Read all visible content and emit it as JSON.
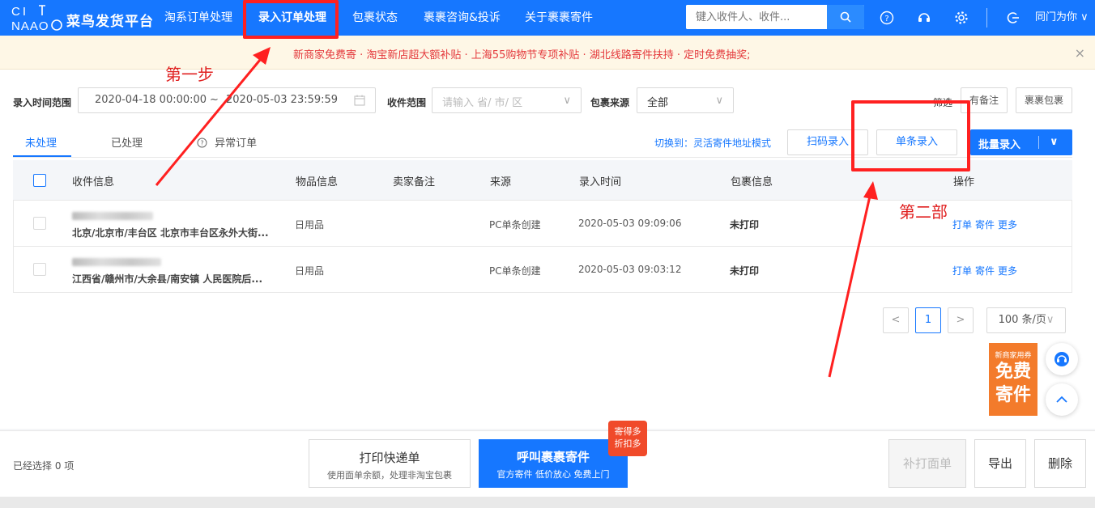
{
  "nav": {
    "logo_text": "菜鸟发货平台",
    "items": [
      "淘系订单处理",
      "录入订单处理",
      "包裹状态",
      "裹裹咨询&投诉",
      "关于裹裹寄件"
    ],
    "search_placeholder": "键入收件人、收件...",
    "user": "同门为你"
  },
  "notice": {
    "text": "新商家免费寄 · 淘宝新店超大额补贴 · 上海55购物节专项补贴 · 湖北线路寄件扶持 · 定时免费抽奖;",
    "close": "×"
  },
  "filters": {
    "time_label": "录入时间范围",
    "start": "2020-04-18 00:00:00",
    "sep": "~",
    "end": "2020-05-03 23:59:59",
    "area_label": "收件范围",
    "area_placeholder": "请输入 省/ 市/ 区",
    "source_label": "包裹来源",
    "source_value": "全部",
    "screen_label": "筛选",
    "has_note": "有备注",
    "guoguo": "裹裹包裹"
  },
  "tabs": [
    "未处理",
    "已处理",
    "异常订单"
  ],
  "actions": {
    "switch": "切换到：灵活寄件地址模式",
    "scan": "扫码录入",
    "single": "单条录入",
    "batch": "批量录入"
  },
  "table": {
    "headers": [
      "收件信息",
      "物品信息",
      "卖家备注",
      "来源",
      "录入时间",
      "包裹信息",
      "操作"
    ],
    "rows": [
      {
        "address": "北京/北京市/丰台区 北京市丰台区永外大街...",
        "item": "日用品",
        "source": "PC单条创建",
        "time": "2020-05-03 09:09:06",
        "status": "未打印",
        "ops": [
          "打单",
          "寄件",
          "更多"
        ]
      },
      {
        "address": "江西省/赣州市/大余县/南安镇 人民医院后...",
        "item": "日用品",
        "source": "PC单条创建",
        "time": "2020-05-03 09:03:12",
        "status": "未打印",
        "ops": [
          "打单",
          "寄件",
          "更多"
        ]
      }
    ]
  },
  "pagination": {
    "prev": "<",
    "page": "1",
    "next": ">",
    "page_size": "100 条/页"
  },
  "annotations": {
    "step1": "第一步",
    "step2": "第二部"
  },
  "promo": {
    "small": "新商家用券",
    "line1": "免费",
    "line2": "寄件"
  },
  "bottom": {
    "selected": "已经选择 0 项",
    "print_title": "打印快递单",
    "print_sub": "使用面单余额，处理非淘宝包裹",
    "call_title": "呼叫裹裹寄件",
    "call_sub": "官方寄件 低价放心 免费上门",
    "badge_line1": "寄得多",
    "badge_line2": "折扣多",
    "reprint": "补打面单",
    "export": "导出",
    "delete": "删除"
  },
  "colors": {
    "primary": "#1677ff",
    "annotation": "#ff2020",
    "notice": "#e4393c",
    "promo": "#f37b2b"
  }
}
